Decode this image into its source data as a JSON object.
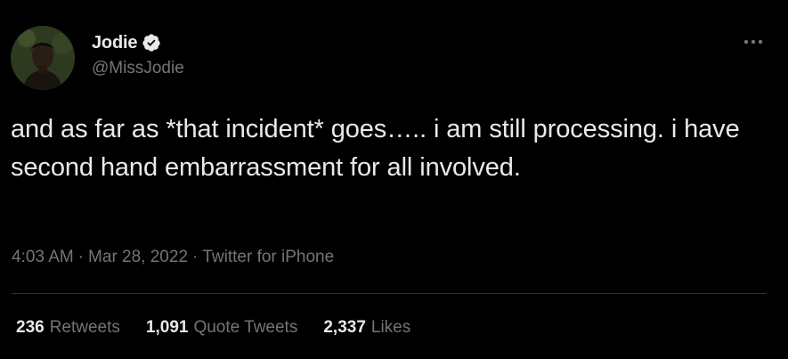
{
  "author": {
    "display_name": "Jodie",
    "handle": "@MissJodie",
    "verified": true,
    "avatar_icon": "profile-photo"
  },
  "tweet": {
    "text": "and as far as *that incident* goes….. i am still processing. i have second hand embarrassment for all involved."
  },
  "meta": {
    "time": "4:03 AM",
    "date": "Mar 28, 2022",
    "separator": "·",
    "source": "Twitter for iPhone"
  },
  "stats": [
    {
      "count": "236",
      "label": "Retweets"
    },
    {
      "count": "1,091",
      "label": "Quote Tweets"
    },
    {
      "count": "2,337",
      "label": "Likes"
    }
  ],
  "colors": {
    "background": "#000000",
    "primary_text": "#e7e9ea",
    "secondary_text": "#71767b",
    "divider": "#2f3336",
    "verified_badge": "#e7e9ea"
  },
  "icons": {
    "more": "more-horizontal-icon",
    "verified": "verified-badge-icon"
  }
}
